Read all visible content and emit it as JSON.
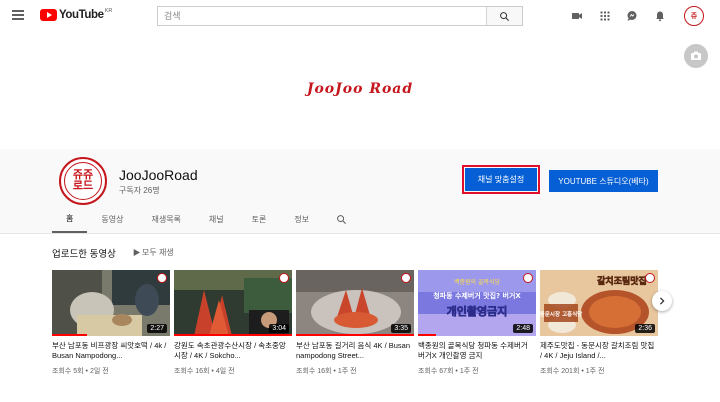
{
  "topbar": {
    "logo_text": "YouTube",
    "logo_region": "KR",
    "search_placeholder": "검색"
  },
  "banner": {
    "title": "JooJoo Road"
  },
  "channel": {
    "name": "JooJooRoad",
    "subscribers": "구독자 26명",
    "avatar_text": "쥬쥬\n로드",
    "customize_label": "채널 맞춤설정",
    "studio_label": "YOUTUBE 스튜디오(베타)"
  },
  "tabs": [
    "홈",
    "동영상",
    "재생목록",
    "채널",
    "토론",
    "정보"
  ],
  "section": {
    "title": "업로드한 동영상",
    "play_all": "모두 재생"
  },
  "videos": [
    {
      "title": "부산 남포동 비프광장 씨앗호떡 / 4k / Busan Nampodong...",
      "meta": "조회수 5회 • 2일 전",
      "duration": "2:27",
      "colors": [
        "#6b6b5a",
        "#b9a88e"
      ],
      "progress": 0.3
    },
    {
      "title": "강원도 속초관광수산시장 / 속초중앙시장 / 4K / Sokcho...",
      "meta": "조회수 16회 • 4일 전",
      "duration": "3:04",
      "colors": [
        "#3a4a3a",
        "#c94a2b"
      ],
      "progress": 1.0
    },
    {
      "title": "부산 남포동 길거리 음식 4K / Busan nampodong Street...",
      "meta": "조회수 16회 • 1주 전",
      "duration": "3:35",
      "colors": [
        "#8a7f7a",
        "#d44a2c"
      ],
      "progress": 1.0
    },
    {
      "title": "백종원의 골목식당 청파동 수제버거 버거X 개인촬영 금지",
      "meta": "조회수 67회 • 1주 전",
      "duration": "2:48",
      "colors": [
        "#6a6ad8",
        "#b9a8f0"
      ],
      "progress": 0.15
    },
    {
      "title": "제주도맛집 - 동문시장 갈치조림 맛집 / 4K / Jeju Island /...",
      "meta": "조회수 201회 • 1주 전",
      "duration": "2:36",
      "colors": [
        "#b65a2a",
        "#f3c891"
      ],
      "progress": 0
    }
  ],
  "thumb_captions": {
    "v4_top": "백종원의 골목식당",
    "v4_mid": "청파동 수제버거 맛집? 버거X",
    "v4_big": "개인촬영금지",
    "v5_top": "갈치조림맛집",
    "v5_badge": "동문시장 고흥식당"
  }
}
